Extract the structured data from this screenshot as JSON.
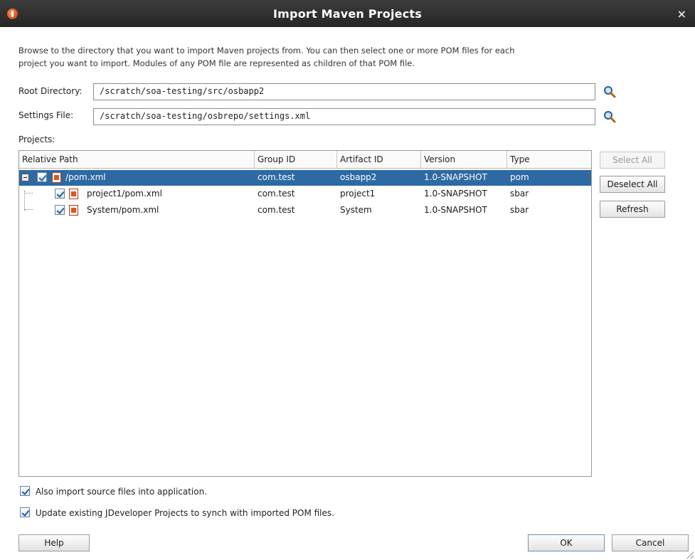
{
  "window": {
    "title": "Import Maven Projects",
    "close_glyph": "×"
  },
  "intro": {
    "line1": "Browse to the directory that you want to import Maven projects from. You can then select one or more POM files for each",
    "line2": "project you want to import. Modules of any POM file are represented as children of that POM file."
  },
  "root_directory": {
    "label": "Root Directory:",
    "value": "/scratch/soa-testing/src/osbapp2"
  },
  "settings_file": {
    "label": "Settings File:",
    "value": "/scratch/soa-testing/osbrepo/settings.xml"
  },
  "projects": {
    "label": "Projects:",
    "columns": [
      "Relative Path",
      "Group ID",
      "Artifact ID",
      "Version",
      "Type"
    ],
    "rows": [
      {
        "path": "/pom.xml",
        "group_id": "com.test",
        "artifact_id": "osbapp2",
        "version": "1.0-SNAPSHOT",
        "type": "pom",
        "checked": true,
        "selected": true
      },
      {
        "path": "project1/pom.xml",
        "group_id": "com.test",
        "artifact_id": "project1",
        "version": "1.0-SNAPSHOT",
        "type": "sbar",
        "checked": true,
        "selected": false
      },
      {
        "path": "System/pom.xml",
        "group_id": "com.test",
        "artifact_id": "System",
        "version": "1.0-SNAPSHOT",
        "type": "sbar",
        "checked": true,
        "selected": false
      }
    ]
  },
  "side_buttons": {
    "select_all": "Select All",
    "deselect_all": "Deselect All",
    "refresh": "Refresh"
  },
  "options": {
    "import_sources": {
      "label": "Also import source files into application.",
      "checked": true
    },
    "update_projects": {
      "label": "Update existing JDeveloper Projects to synch with imported POM files.",
      "checked": true
    }
  },
  "footer": {
    "help": "Help",
    "ok": "OK",
    "cancel": "Cancel"
  },
  "colors": {
    "selection": "#2d6aa3",
    "titlebar": "#2e2e2e"
  },
  "icons": {
    "app": "oracle-app-icon",
    "browse": "magnifier-icon",
    "pom": "pom-file-icon"
  }
}
